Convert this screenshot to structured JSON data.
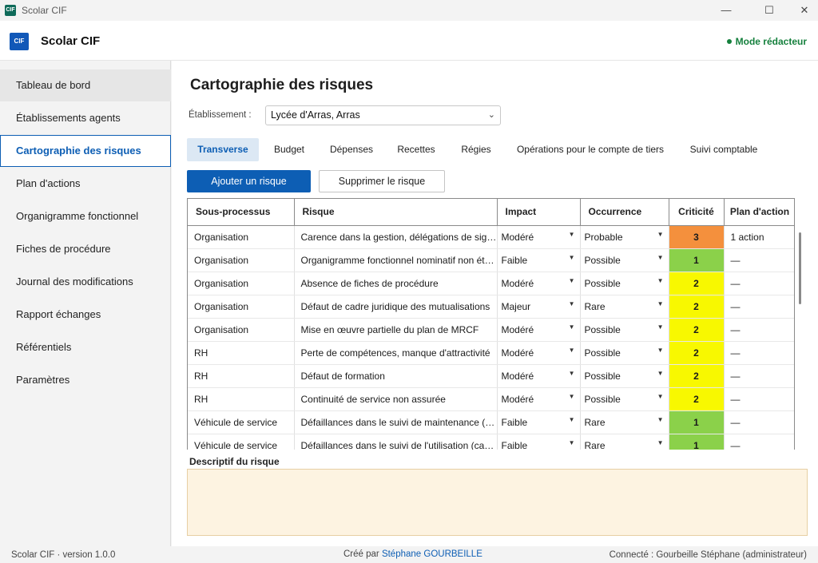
{
  "window": {
    "title": "Scolar CIF",
    "logo_text": "CIF",
    "minimize": "—",
    "maximize": "☐",
    "close": "✕"
  },
  "header": {
    "logo_text": "CIF",
    "app_name": "Scolar CIF",
    "mode": "Mode rédacteur",
    "mode_color": "#15803d"
  },
  "sidebar": {
    "items": [
      {
        "label": "Tableau de bord"
      },
      {
        "label": "Établissements  agents"
      },
      {
        "label": "Cartographie des risques"
      },
      {
        "label": "Plan d'actions"
      },
      {
        "label": "Organigramme fonctionnel"
      },
      {
        "label": "Fiches de procédure"
      },
      {
        "label": "Journal des modifications"
      },
      {
        "label": "Rapport  échanges"
      },
      {
        "label": "Référentiels"
      },
      {
        "label": "Paramètres"
      }
    ]
  },
  "main": {
    "title": "Cartographie des risques",
    "etablissement_label": "Établissement :",
    "etablissement_value": "Lycée d'Arras, Arras",
    "tabs": [
      {
        "label": "Transverse"
      },
      {
        "label": "Budget"
      },
      {
        "label": "Dépenses"
      },
      {
        "label": "Recettes"
      },
      {
        "label": "Régies"
      },
      {
        "label": "Opérations pour le compte de tiers"
      },
      {
        "label": "Suivi comptable"
      }
    ],
    "add_button": "Ajouter un risque",
    "delete_button": "Supprimer le risque",
    "table": {
      "columns": [
        "Sous-processus",
        "Risque",
        "Impact",
        "Occurrence",
        "Criticité",
        "Plan d'action"
      ],
      "rows": [
        {
          "sous_processus": "Organisation",
          "risque": "Carence dans la gestion, délégations de signature",
          "impact": "Modéré",
          "occurrence": "Probable",
          "criticite": "3",
          "plan": "1 action",
          "color": "#f4903d"
        },
        {
          "sous_processus": "Organisation",
          "risque": "Organigramme fonctionnel nominatif non établi",
          "impact": "Faible",
          "occurrence": "Possible",
          "criticite": "1",
          "plan": "—",
          "color": "#8bd14a"
        },
        {
          "sous_processus": "Organisation",
          "risque": "Absence de fiches de procédure",
          "impact": "Modéré",
          "occurrence": "Possible",
          "criticite": "2",
          "plan": "—",
          "color": "#f8f800"
        },
        {
          "sous_processus": "Organisation",
          "risque": "Défaut de cadre juridique des mutualisations",
          "impact": "Majeur",
          "occurrence": "Rare",
          "criticite": "2",
          "plan": "—",
          "color": "#f8f800"
        },
        {
          "sous_processus": "Organisation",
          "risque": "Mise en œuvre partielle du plan de MRCF",
          "impact": "Modéré",
          "occurrence": "Possible",
          "criticite": "2",
          "plan": "—",
          "color": "#f8f800"
        },
        {
          "sous_processus": "RH",
          "risque": "Perte de compétences, manque d'attractivité",
          "impact": "Modéré",
          "occurrence": "Possible",
          "criticite": "2",
          "plan": "—",
          "color": "#f8f800"
        },
        {
          "sous_processus": "RH",
          "risque": "Défaut de formation",
          "impact": "Modéré",
          "occurrence": "Possible",
          "criticite": "2",
          "plan": "—",
          "color": "#f8f800"
        },
        {
          "sous_processus": "RH",
          "risque": "Continuité de service non assurée",
          "impact": "Modéré",
          "occurrence": "Possible",
          "criticite": "2",
          "plan": "—",
          "color": "#f8f800"
        },
        {
          "sous_processus": "Véhicule de service",
          "risque": "Défaillances dans le suivi de maintenance (suivi)",
          "impact": "Faible",
          "occurrence": "Rare",
          "criticite": "1",
          "plan": "—",
          "color": "#8bd14a"
        },
        {
          "sous_processus": "Véhicule de service",
          "risque": "Défaillances dans le suivi de l'utilisation (carnet)",
          "impact": "Faible",
          "occurrence": "Rare",
          "criticite": "1",
          "plan": "—",
          "color": "#8bd14a"
        }
      ]
    },
    "descriptif_title": "Descriptif du risque"
  },
  "footer": {
    "left": "Scolar CIF  ·  version 1.0.0",
    "created_prefix": "Créé par ",
    "author": "Stéphane GOURBEILLE",
    "right": "Connecté : Gourbeille Stéphane  (administrateur)"
  }
}
